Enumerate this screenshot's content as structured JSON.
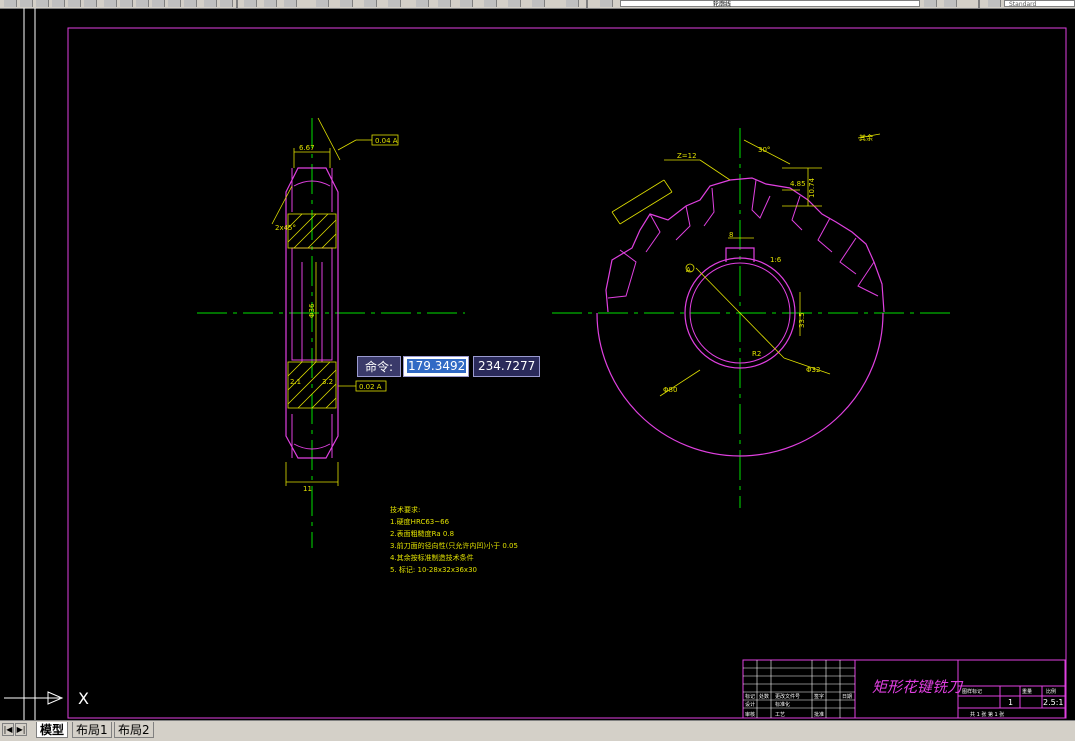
{
  "toolbar": {
    "layer_name": "轮廓线",
    "text_style": "Standard"
  },
  "command_tip": {
    "label": "命令:",
    "x_value": "179.3492",
    "y_value": "234.7277"
  },
  "ucs": {
    "x_label": "X"
  },
  "layout_tabs": [
    {
      "label": "模型",
      "active": true
    },
    {
      "label": "布局1",
      "active": false
    },
    {
      "label": "布局2",
      "active": false
    }
  ],
  "nav_buttons": [
    "|◀",
    "◀",
    "▶",
    "▶|"
  ],
  "title_block": {
    "drawing_title": "矩形花键铣刀",
    "scale_value": "2.5:1",
    "qty_value": "1",
    "sheet_text": "共 1 张   第 1 张",
    "header_cells": [
      "图样标记",
      "重量",
      "比例"
    ],
    "rev_cells": [
      "标记",
      "处数",
      "更改文件号",
      "签字",
      "日期"
    ],
    "role_cells": [
      "设计",
      "标准化",
      "审核",
      "工艺",
      "批准"
    ]
  },
  "tech_notes": {
    "title": "技术要求:",
    "lines": [
      "1.硬度HRC63~66",
      "2.表面粗糙度Ra 0.8",
      "3.前刀面的径向性(只允许内凹)小于 0.05",
      "4.其余按标准制造技术条件",
      "5. 标记: 10-28x32x36x30"
    ]
  },
  "annotations": {
    "tolerance_top": "0.04 A",
    "tolerance_bottom": "0.02 A",
    "tooth_count": "Z=12",
    "roughness_note": "其余",
    "dim_top": "6.67",
    "dim_width": "11",
    "dim_bore": "Φ36",
    "dim_outer": "Φ80",
    "dim_keyway": "33.5",
    "dim_key_w": "8",
    "dim_depth": "10.74",
    "dim_tooth": "4.85",
    "dim_angle": "30°",
    "dim_ref": "1:6",
    "dim_chamfer": "2x45°",
    "dim_radius": "R2",
    "dim_bore2": "Φ32",
    "dim_left": "2.1",
    "dim_right": "3.2",
    "datum": "A"
  }
}
